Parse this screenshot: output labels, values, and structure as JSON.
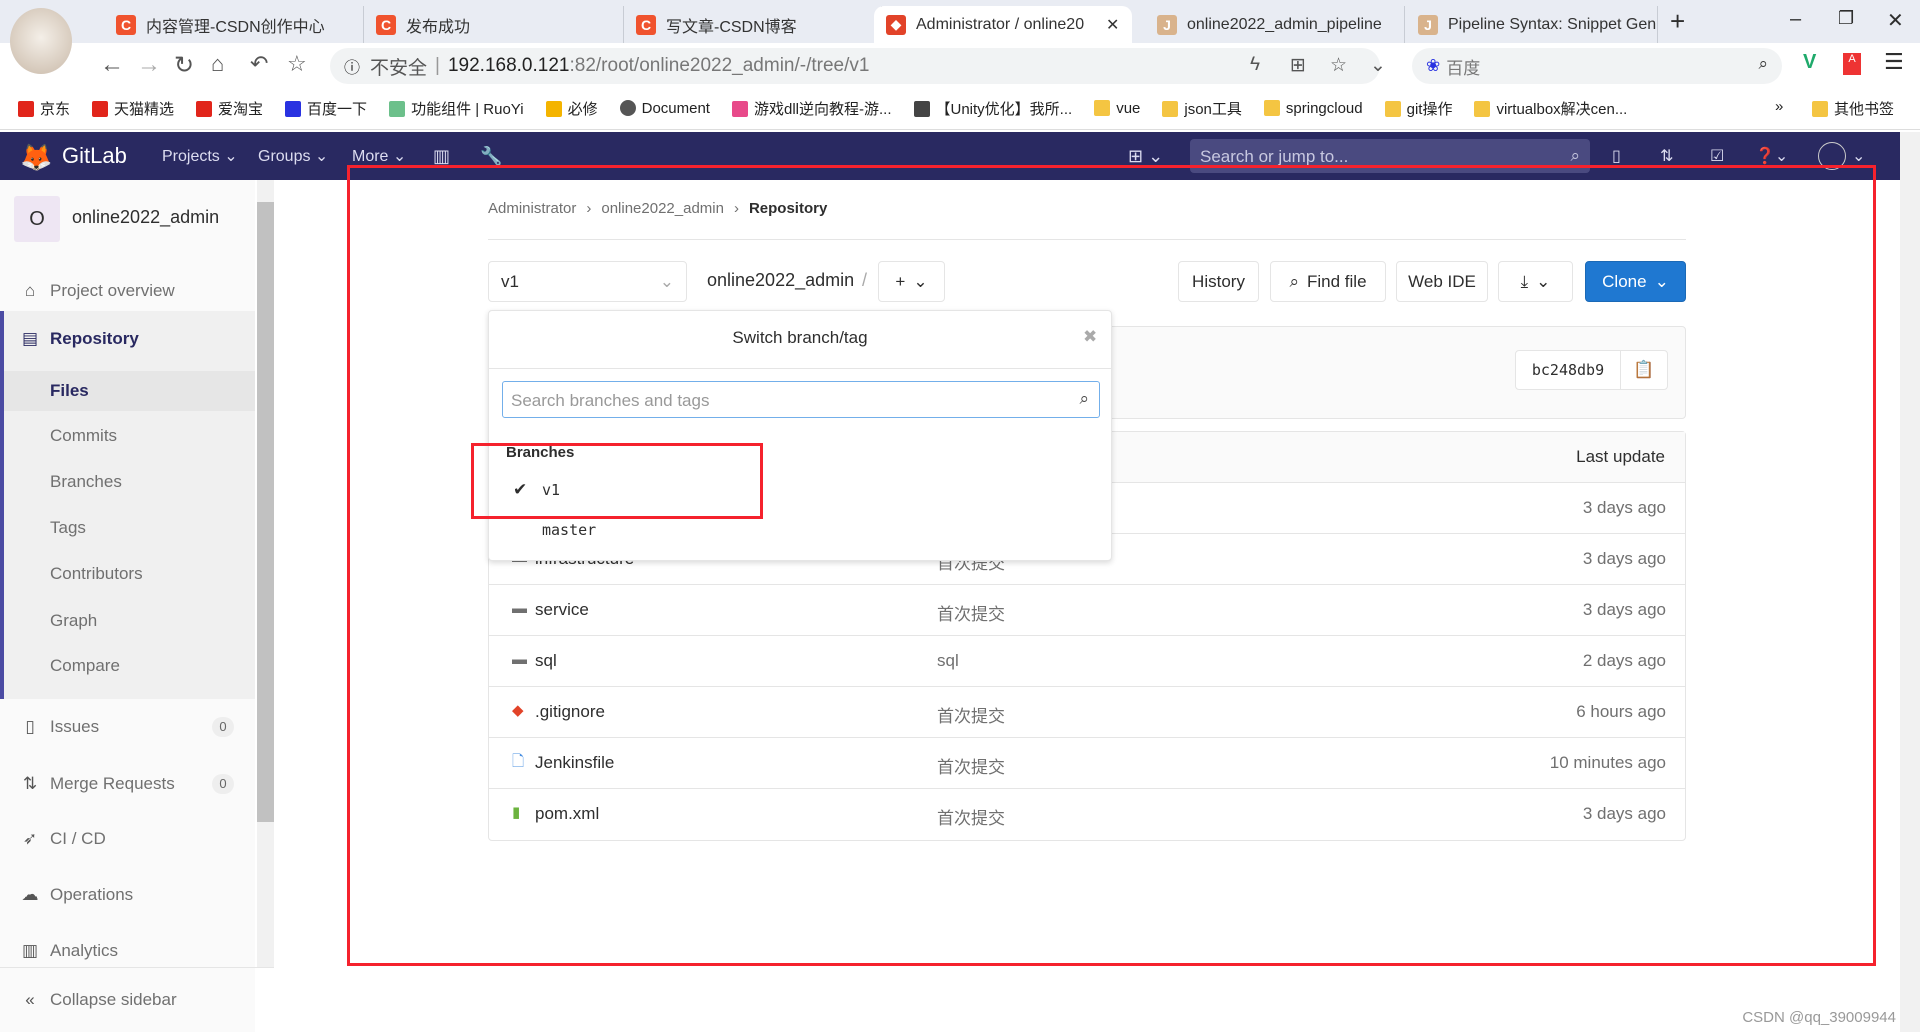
{
  "browser": {
    "tabs": [
      {
        "label": "内容管理-CSDN创作中心"
      },
      {
        "label": "发布成功"
      },
      {
        "label": "写文章-CSDN博客"
      },
      {
        "label": "Administrator / online20"
      },
      {
        "label": "online2022_admin_pipeline"
      },
      {
        "label": "Pipeline Syntax: Snippet Gen"
      }
    ],
    "insecure": "不安全",
    "url_host": "192.168.0.121",
    "url_rest": ":82/root/online2022_admin/-/tree/v1",
    "search_engine": "百度",
    "bookmarks": [
      "京东",
      "天猫精选",
      "爱淘宝",
      "百度一下",
      "功能组件 | RuoYi",
      "必修",
      "Document",
      "游戏dll逆向教程-游...",
      "【Unity优化】我所...",
      "vue",
      "json工具",
      "springcloud",
      "git操作",
      "virtualbox解决cen..."
    ],
    "more_bookmarks": "»",
    "other_bookmarks": "其他书签"
  },
  "gitlab": {
    "brand": "GitLab",
    "nav": [
      "Projects",
      "Groups",
      "More"
    ],
    "search_placeholder": "Search or jump to...",
    "accent": "#292961"
  },
  "sidebar": {
    "avatar_letter": "O",
    "project": "online2022_admin",
    "overview": "Project overview",
    "repository": "Repository",
    "sub": [
      "Files",
      "Commits",
      "Branches",
      "Tags",
      "Contributors",
      "Graph",
      "Compare"
    ],
    "issues": "Issues",
    "issues_count": "0",
    "mr": "Merge Requests",
    "mr_count": "0",
    "cicd": "CI / CD",
    "operations": "Operations",
    "analytics": "Analytics",
    "collapse": "Collapse sidebar"
  },
  "breadcrumb": [
    "Administrator",
    "online2022_admin",
    "Repository"
  ],
  "toolbar": {
    "branch": "v1",
    "path": "online2022_admin",
    "sep": "/",
    "history": "History",
    "find": "Find file",
    "webide": "Web IDE",
    "clone": "Clone",
    "clone_color": "#1f78d1"
  },
  "commit": {
    "sha": "bc248db9"
  },
  "dropdown": {
    "title": "Switch branch/tag",
    "search_placeholder": "Search branches and tags",
    "section": "Branches",
    "branches": [
      "v1",
      "master"
    ],
    "selected": "v1"
  },
  "table": {
    "last_update": "Last update",
    "rows": [
      {
        "name": "",
        "msg": "",
        "date": "3 days ago",
        "icon": "folder"
      },
      {
        "name": "infrastructure",
        "msg": "首次提交",
        "date": "3 days ago",
        "icon": "folder"
      },
      {
        "name": "service",
        "msg": "首次提交",
        "date": "3 days ago",
        "icon": "folder"
      },
      {
        "name": "sql",
        "msg": "sql",
        "date": "2 days ago",
        "icon": "folder"
      },
      {
        "name": ".gitignore",
        "msg": "首次提交",
        "date": "6 hours ago",
        "icon": "git"
      },
      {
        "name": "Jenkinsfile",
        "msg": "首次提交",
        "date": "10 minutes ago",
        "icon": "file"
      },
      {
        "name": "pom.xml",
        "msg": "首次提交",
        "date": "3 days ago",
        "icon": "xml"
      }
    ]
  },
  "watermark": "CSDN @qq_39009944"
}
